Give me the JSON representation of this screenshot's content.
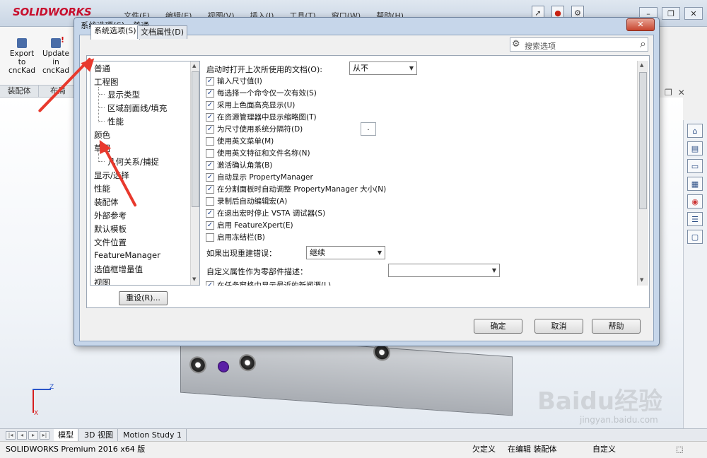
{
  "app": {
    "logo": "SOLIDWORKS",
    "menu": [
      "文件(F)",
      "编辑(E)",
      "视图(V)",
      "插入(I)",
      "工具(T)",
      "窗口(W)",
      "帮助(H)"
    ],
    "ribbon_buttons": [
      "Export to cncKad",
      "Update in cncKad"
    ],
    "command_tabs": [
      "装配体",
      "布局"
    ],
    "bottom_tabs": [
      "模型",
      "3D 视图",
      "Motion Study 1"
    ],
    "status": {
      "product": "SOLIDWORKS Premium 2016 x64 版",
      "definition": "欠定义",
      "editing": "在编辑 装配体",
      "custom": "自定义"
    },
    "triad_labels": {
      "z": "Z",
      "x": "X"
    },
    "watermark": "Baidu经验",
    "watermark_sub": "jingyan.baidu.com"
  },
  "dialog": {
    "title": "系统选项(S) - 普通",
    "close_label": "✕",
    "tabs": [
      "系统选项(S)",
      "文档属性(D)"
    ],
    "search_placeholder": "搜索选项",
    "tree": [
      {
        "label": "普通",
        "level": 0
      },
      {
        "label": "工程图",
        "level": 0
      },
      {
        "label": "显示类型",
        "level": 1
      },
      {
        "label": "区域剖面线/填充",
        "level": 1
      },
      {
        "label": "性能",
        "level": 1
      },
      {
        "label": "颜色",
        "level": 0
      },
      {
        "label": "草图",
        "level": 0
      },
      {
        "label": "几何关系/捕捉",
        "level": 1
      },
      {
        "label": "显示/选择",
        "level": 0
      },
      {
        "label": "性能",
        "level": 0
      },
      {
        "label": "装配体",
        "level": 0
      },
      {
        "label": "外部参考",
        "level": 0
      },
      {
        "label": "默认模板",
        "level": 0
      },
      {
        "label": "文件位置",
        "level": 0
      },
      {
        "label": "FeatureManager",
        "level": 0
      },
      {
        "label": "选值框增量值",
        "level": 0
      },
      {
        "label": "视图",
        "level": 0
      }
    ],
    "reset_label": "重设(R)...",
    "startup_label": "启动时打开上次所使用的文档(O):",
    "startup_value": "从不",
    "separator_value": ".",
    "checkboxes": [
      {
        "label": "输入尺寸值(I)",
        "checked": true
      },
      {
        "label": "每选择一个命令仅一次有效(S)",
        "checked": true
      },
      {
        "label": "采用上色面高亮显示(U)",
        "checked": true
      },
      {
        "label": "在资源管理器中显示缩略图(T)",
        "checked": true
      },
      {
        "label": "为尺寸使用系统分隔符(D)",
        "checked": true
      },
      {
        "label": "使用英文菜单(M)",
        "checked": false
      },
      {
        "label": "使用英文特征和文件名称(N)",
        "checked": false
      },
      {
        "label": "激活确认角落(B)",
        "checked": true
      },
      {
        "label": "自动显示 PropertyManager",
        "checked": true
      },
      {
        "label": "在分割面板时自动调整 PropertyManager 大小(N)",
        "checked": true
      },
      {
        "label": "录制后自动编辑宏(A)",
        "checked": false
      },
      {
        "label": "在退出宏时停止 VSTA 调试器(S)",
        "checked": true
      },
      {
        "label": "启用 FeatureXpert(E)",
        "checked": true
      },
      {
        "label": "启用冻结栏(B)",
        "checked": false
      }
    ],
    "rebuild_error_label": "如果出现重建错误：",
    "rebuild_error_value": "继续",
    "custom_prop_label": "自定义属性作为零部件描述：",
    "custom_prop_value": "",
    "last_checkbox": {
      "label": "在任务窗格中显示最近的新闻源(L)",
      "checked": true
    },
    "buttons": {
      "ok": "确定",
      "cancel": "取消",
      "help": "帮助"
    }
  },
  "colors": {
    "accent_red": "#e8392d",
    "dialog_frame": "#c6d6ea",
    "checkbox_mark": "#1d3f8a"
  }
}
